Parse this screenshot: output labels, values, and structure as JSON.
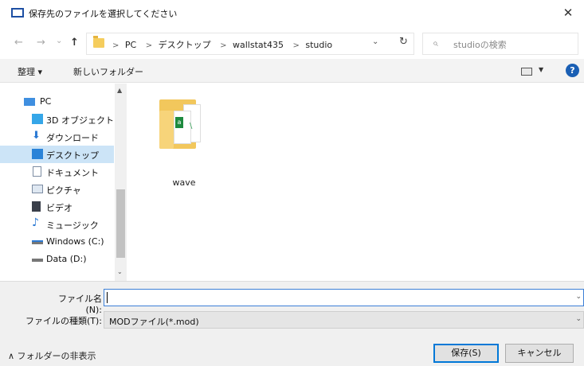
{
  "window": {
    "title": "保存先のファイルを選択してください",
    "close_glyph": "✕"
  },
  "nav": {
    "back": "←",
    "forward": "→",
    "recent": "⌄",
    "up": "↑"
  },
  "address": {
    "crumbs": [
      "PC",
      "デスクトップ",
      "wallstat435",
      "studio"
    ],
    "dropdown": "⌄",
    "refresh": "↻"
  },
  "search": {
    "placeholder": "studioの検索",
    "icon": "⌕"
  },
  "toolbar": {
    "organize": "整理 ▾",
    "new_folder": "新しいフォルダー",
    "view_dropdown": "▼",
    "help": "?"
  },
  "sidebar": {
    "items": [
      {
        "label": "PC",
        "icon": "pc-icon"
      },
      {
        "label": "3D オブジェクト",
        "icon": "3d-objects-icon"
      },
      {
        "label": "ダウンロード",
        "icon": "download-icon"
      },
      {
        "label": "デスクトップ",
        "icon": "desktop-icon",
        "selected": true
      },
      {
        "label": "ドキュメント",
        "icon": "document-icon"
      },
      {
        "label": "ピクチャ",
        "icon": "pictures-icon"
      },
      {
        "label": "ビデオ",
        "icon": "video-icon"
      },
      {
        "label": "ミュージック",
        "icon": "music-icon"
      },
      {
        "label": "Windows (C:)",
        "icon": "drive-c-icon"
      },
      {
        "label": "Data (D:)",
        "icon": "drive-d-icon"
      }
    ],
    "scroll_up": "▲",
    "scroll_down": "⌄"
  },
  "content": {
    "folders": [
      {
        "name": "wave",
        "icon": "folder-icon"
      }
    ]
  },
  "bottom": {
    "filename_label": "ファイル名(N):",
    "filename_value": "",
    "filetype_label": "ファイルの種類(T):",
    "filetype_value": "MODファイル(*.mod)",
    "dropdown": "⌄",
    "hide_folders": "∧ フォルダーの非表示",
    "save_button": "保存(S)",
    "cancel_button": "キャンセル"
  },
  "colors": {
    "accent": "#0078d7",
    "selection": "#cce4f7",
    "toolbar_bg": "#f3f3f3",
    "footer_bg": "#f0f0f0"
  }
}
